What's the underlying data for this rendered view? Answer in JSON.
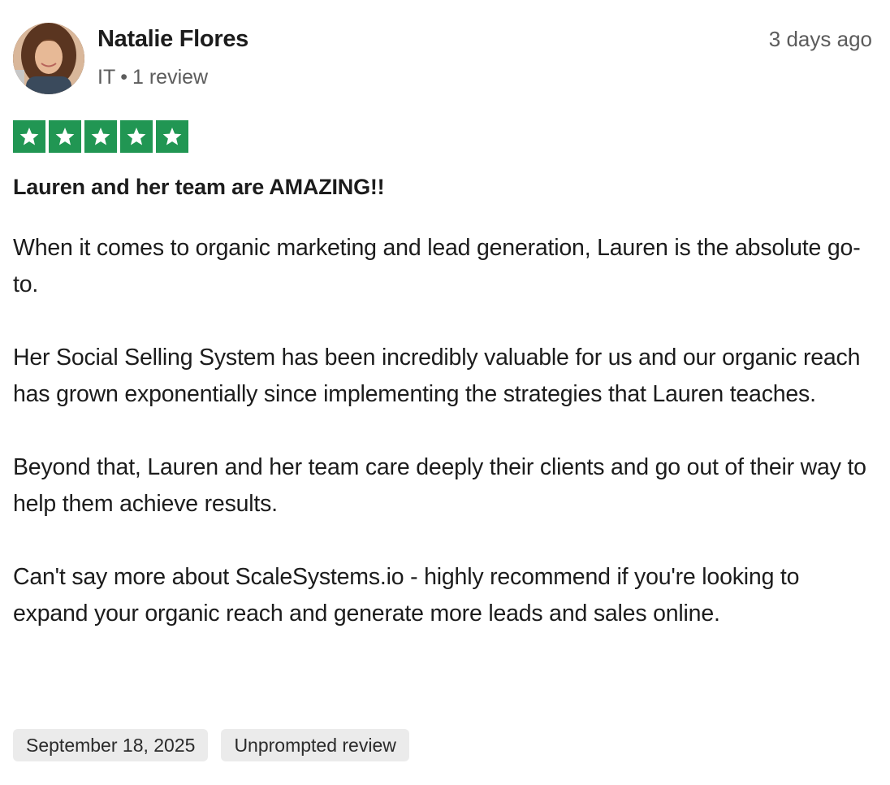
{
  "reviewer": {
    "name": "Natalie Flores",
    "country": "IT",
    "separator": "•",
    "review_count": "1 review"
  },
  "review": {
    "relative_date": "3 days ago",
    "rating": 5,
    "rating_max": 5,
    "star_color": "#219653",
    "title": "Lauren and her team are AMAZING!!",
    "paragraphs": [
      "When it comes to organic marketing and lead generation, Lauren is the absolute go-to.",
      "Her Social Selling System has been incredibly valuable for us and our organic reach has grown exponentially since implementing the strategies that Lauren teaches.",
      "Beyond that, Lauren and her team care deeply their clients and go out of their way to help them achieve results.",
      "Can't say more about ScaleSystems.io - highly recommend if you're looking to expand your organic reach and generate more leads and sales online."
    ],
    "tags": [
      "September 18, 2025",
      "Unprompted review"
    ]
  },
  "icons": {
    "avatar": "user-avatar-photo",
    "star": "star-icon"
  }
}
